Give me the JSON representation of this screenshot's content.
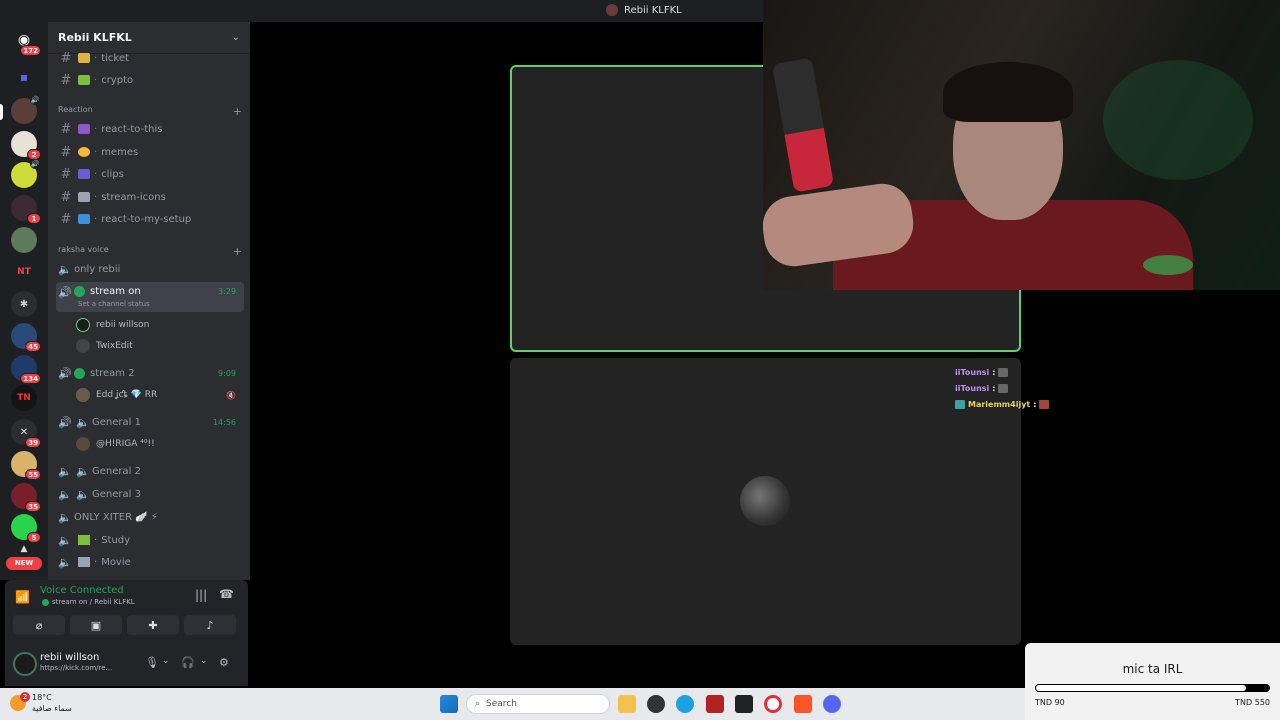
{
  "window_title": "Rebii KLFKL",
  "server_rail": {
    "home_badge": "172",
    "badges": [
      "2",
      "1",
      "45",
      "134",
      "39",
      "55",
      "35",
      "5"
    ],
    "new_label": "NEW"
  },
  "guild": {
    "name": "Rebii KLFKL"
  },
  "channels_top": [
    {
      "label": "ticket",
      "emoji_color": "#e3b341"
    },
    {
      "label": "crypto",
      "emoji_color": "#7fbf3f"
    }
  ],
  "categories": {
    "reaction": "Reaction",
    "voice": "raksha voice"
  },
  "reaction_channels": [
    {
      "label": "react-to-this",
      "emoji_color": "#8e5ac8"
    },
    {
      "label": "memes",
      "emoji_color": "#f4b93c"
    },
    {
      "label": "clips",
      "emoji_color": "#6c5bd4"
    },
    {
      "label": "stream-icons",
      "emoji_color": "#9aa3b5"
    },
    {
      "label": "react-to-my-setup",
      "emoji_color": "#3d8fe0"
    }
  ],
  "voice_channels": {
    "only_rebii": "only rebii",
    "stream_on": {
      "label": "stream on",
      "time": "3:29",
      "status": "Set a channel status"
    },
    "stream_on_members": [
      "rebii willson",
      "TwixEdit"
    ],
    "stream_2": {
      "label": "stream 2",
      "time": "9:09"
    },
    "stream_2_members": [
      "Edd ʝƈȶ 💎 RR"
    ],
    "general_1": {
      "label": "General 1",
      "time": "14:56"
    },
    "general_1_members": [
      "@H!RIGA ⁴⁰!!"
    ],
    "general_2": "General 2",
    "general_3": "General 3",
    "only_xiter": "ONLY XITER 🪽 ⚡",
    "study": "Study",
    "movie": "Movie"
  },
  "voice_panel": {
    "title": "Voice Connected",
    "subtitle": "stream on / Rebii KLFKL"
  },
  "user_panel": {
    "name": "rebii willson",
    "status": "https://kick.com/re..."
  },
  "chat": [
    {
      "user": "iiTounsi",
      "sep": ":"
    },
    {
      "user": "iiTounsi",
      "sep": ":"
    },
    {
      "user": "Mariemm4ijyt",
      "sep": ":"
    }
  ],
  "goal": {
    "title": "mic ta IRL",
    "current": "TND 90",
    "target": "TND 550",
    "progress_fraction": 0.9
  },
  "taskbar": {
    "temp": "18°C",
    "weather": "سماء صافية",
    "weather_badge": "2",
    "search_placeholder": "Search"
  },
  "colors": {
    "accent_green": "#23a55a",
    "tile_border": "#5fcf72",
    "badge_red": "#f23f43"
  }
}
